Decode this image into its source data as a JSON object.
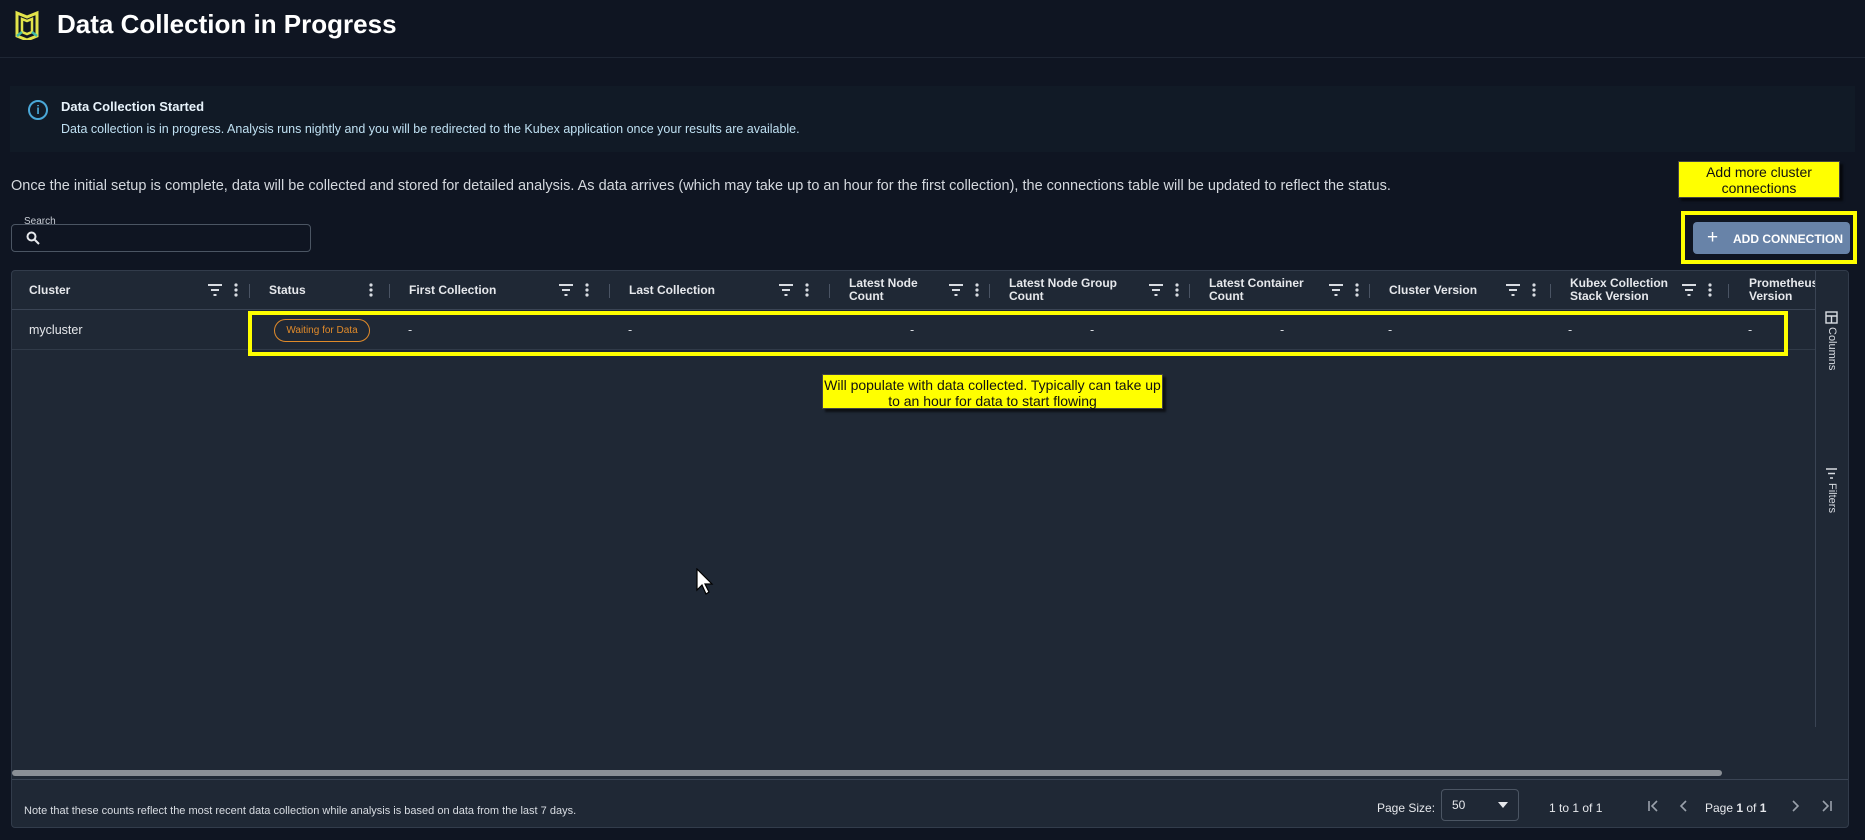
{
  "header": {
    "title": "Data Collection in Progress",
    "logo": "cube-logo-icon"
  },
  "banner": {
    "title": "Data Collection Started",
    "text": "Data collection is in progress. Analysis runs nightly and you will be redirected to the Kubex application once your results are available.",
    "icon": "info-icon"
  },
  "intro_text": "Once the initial setup is complete, data will be collected and stored for detailed analysis. As data arrives (which may take up to an hour for the first collection), the connections table will be updated to reflect the status.",
  "annotations": {
    "add_more": "Add more cluster connections",
    "populate": "Will populate with data collected. Typically can take up to an hour for data to start flowing"
  },
  "search": {
    "label": "Search",
    "value": "",
    "placeholder": ""
  },
  "add_connection": {
    "label": "ADD CONNECTION",
    "icon": "plus-icon"
  },
  "grid": {
    "columns": [
      {
        "l1": "Cluster",
        "l2": ""
      },
      {
        "l1": "Status",
        "l2": ""
      },
      {
        "l1": "First Collection",
        "l2": ""
      },
      {
        "l1": "Last Collection",
        "l2": ""
      },
      {
        "l1": "Latest Node",
        "l2": "Count"
      },
      {
        "l1": "Latest Node Group",
        "l2": "Count"
      },
      {
        "l1": "Latest Container",
        "l2": "Count"
      },
      {
        "l1": "Cluster Version",
        "l2": ""
      },
      {
        "l1": "Kubex Collection",
        "l2": "Stack Version"
      },
      {
        "l1": "Prometheus",
        "l2": "Version"
      }
    ],
    "rows": [
      {
        "cluster": "mycluster",
        "status": "Waiting for Data",
        "first_collection": "-",
        "last_collection": "-",
        "latest_node_count": "-",
        "latest_node_group_count": "-",
        "latest_container_count": "-",
        "cluster_version": "-",
        "kubex_stack_version": "-",
        "prometheus_version": "-"
      }
    ],
    "side_panels": {
      "columns": "Columns",
      "filters": "Filters"
    }
  },
  "footer": {
    "note": "Note that these counts reflect the most recent data collection while analysis is based on data from the last 7 days.",
    "page_size_label": "Page Size:",
    "page_size_value": "50",
    "range": "1 to 1 of 1",
    "page_prefix": "Page ",
    "page_current": "1",
    "page_mid": " of ",
    "page_total": "1"
  },
  "colors": {
    "background": "#0f1522",
    "grid": "#1f2835",
    "accent_button": "#6883a8",
    "status_waiting": "#e08a2a",
    "callout": "#ffff00"
  }
}
